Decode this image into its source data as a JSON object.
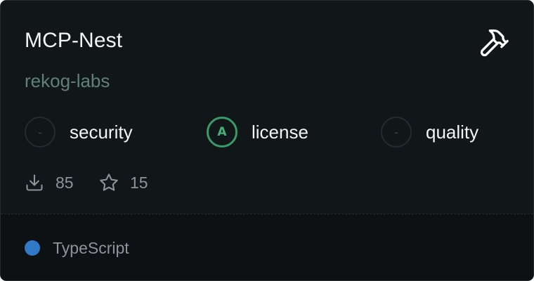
{
  "server": {
    "name": "MCP-Nest",
    "owner": "rekog-labs",
    "type_icon": "hammer-icon"
  },
  "scores": [
    {
      "grade": "-",
      "label": "security"
    },
    {
      "grade": "A",
      "label": "license",
      "color": "#3a9a69"
    },
    {
      "grade": "-",
      "label": "quality"
    }
  ],
  "stats": {
    "downloads": "85",
    "stars": "15"
  },
  "language": {
    "name": "TypeScript",
    "color": "#3178c6"
  }
}
